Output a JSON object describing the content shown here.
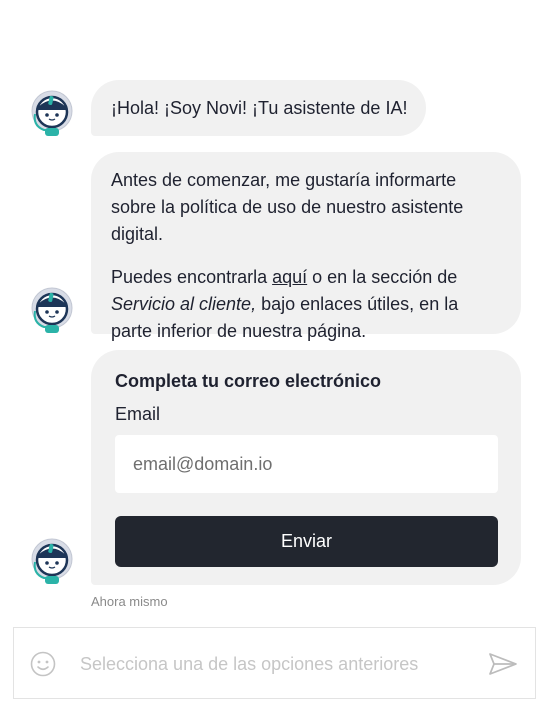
{
  "colors": {
    "bubble_bg": "#f1f1f1",
    "button_bg": "#22262f",
    "button_text": "#ffffff",
    "accent_teal": "#2bb3a8",
    "avatar_navy": "#1d3557"
  },
  "messages": [
    {
      "icon": "robot-avatar-icon",
      "text": "¡Hola! ¡Soy Novi! ¡Tu asistente de IA!"
    },
    {
      "icon": "robot-avatar-icon",
      "paragraph1": "Antes de comenzar, me gustaría informarte sobre la política de uso de nuestro asistente digital.",
      "p2_before": "Puedes encontrarla ",
      "p2_link": "aquí",
      "p2_middle": " o en la sección de ",
      "p2_italic": "Servicio al cliente,",
      "p2_after": " bajo enlaces útiles, en la parte inferior de nuestra página."
    }
  ],
  "form": {
    "icon": "robot-avatar-icon",
    "title": "Completa tu correo electrónico",
    "label": "Email",
    "placeholder": "email@domain.io",
    "value": "",
    "button": "Enviar"
  },
  "timestamp": "Ahora mismo",
  "composer": {
    "emoji_icon": "smiley-icon",
    "placeholder": "Selecciona una de las opciones anteriores",
    "send_icon": "send-icon"
  }
}
